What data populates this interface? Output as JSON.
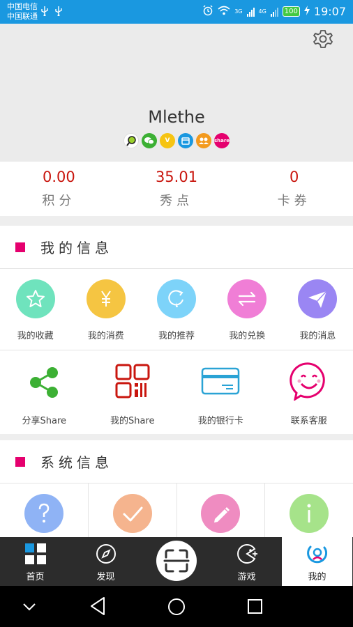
{
  "status_bar": {
    "carrier1": "中国电信",
    "carrier2": "中国联通",
    "net1": "3G",
    "net2": "4G",
    "battery": "100",
    "time": "19:07",
    "icons": [
      "usb-icon",
      "alarm-icon",
      "wifi-icon",
      "signal-icon",
      "charging-icon"
    ]
  },
  "profile": {
    "username": "Mlethe",
    "badges": [
      {
        "icon": "chat-bubble-icon",
        "color": "#ffffff"
      },
      {
        "icon": "wechat-icon",
        "color": "#3cb034"
      },
      {
        "icon": "v-icon",
        "text": "V",
        "color": "#f6c412"
      },
      {
        "icon": "store-icon",
        "color": "#1a98e0"
      },
      {
        "icon": "group-icon",
        "color": "#f39a1e"
      },
      {
        "icon": "share-icon",
        "text": "share",
        "color": "#e5006e"
      }
    ]
  },
  "stats": [
    {
      "value": "0.00",
      "label": "积分"
    },
    {
      "value": "35.01",
      "label": "秀点"
    },
    {
      "value": "0",
      "label": "卡券"
    }
  ],
  "my_info": {
    "title": "我的信息",
    "row1": [
      {
        "label": "我的收藏",
        "icon": "star-icon",
        "color": "#6fe3bd"
      },
      {
        "label": "我的消费",
        "icon": "yen-icon",
        "color": "#f5c542"
      },
      {
        "label": "我的推荐",
        "icon": "recommend-icon",
        "color": "#7dd3f9"
      },
      {
        "label": "我的兑换",
        "icon": "exchange-icon",
        "color": "#f07ed6"
      },
      {
        "label": "我的消息",
        "icon": "send-icon",
        "color": "#9a86f3"
      }
    ],
    "row2": [
      {
        "label": "分享Share",
        "icon": "share-nodes-icon",
        "color": "#3cb034"
      },
      {
        "label": "我的Share",
        "icon": "qr-code-icon",
        "color": "#c9160e"
      },
      {
        "label": "我的银行卡",
        "icon": "bank-card-icon",
        "color": "#2aa3d5"
      },
      {
        "label": "联系客服",
        "icon": "smile-chat-icon",
        "color": "#e5006e"
      }
    ]
  },
  "sys_info": {
    "title": "系统信息",
    "items": [
      {
        "icon": "question-icon",
        "color": "#8fb3f5"
      },
      {
        "icon": "check-icon",
        "color": "#f5b48e"
      },
      {
        "icon": "pencil-icon",
        "color": "#ef8cc1"
      },
      {
        "icon": "info-icon",
        "color": "#a6e38a"
      }
    ]
  },
  "bottom_nav": {
    "items": [
      {
        "label": "首页",
        "icon": "grid-icon"
      },
      {
        "label": "发现",
        "icon": "compass-icon"
      },
      {
        "label": "",
        "icon": "scan-icon"
      },
      {
        "label": "游戏",
        "icon": "game-icon"
      },
      {
        "label": "我的",
        "icon": "profile-icon"
      }
    ]
  },
  "system_nav": [
    "chevron-down-icon",
    "back-icon",
    "home-icon",
    "recents-icon"
  ]
}
